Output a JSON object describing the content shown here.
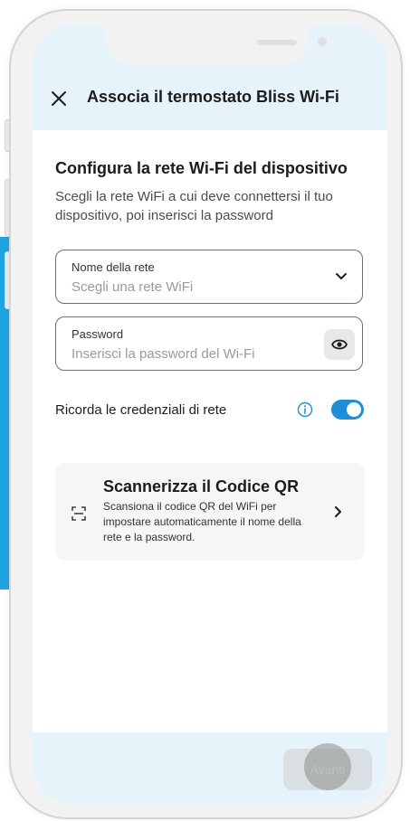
{
  "header": {
    "close_icon": "close-icon",
    "title": "Associa il termostato Bliss Wi-Fi"
  },
  "section": {
    "title": "Configura la rete Wi-Fi del dispositivo",
    "description": "Scegli la rete WiFi a cui deve connettersi il tuo dispositivo, poi inserisci la password"
  },
  "network_field": {
    "label": "Nome della rete",
    "placeholder": "Scegli una rete WiFi",
    "icon": "chevron-down-icon"
  },
  "password_field": {
    "label": "Password",
    "placeholder": "Inserisci la password del Wi-Fi",
    "icon": "eye-icon"
  },
  "remember": {
    "label": "Ricorda le credenziali di rete",
    "info_icon": "info-icon",
    "enabled": true
  },
  "qr_card": {
    "title": "Scannerizza il Codice QR",
    "description": "Scansiona il codice QR del WiFi per impostare automaticamente il nome della rete e la password.",
    "icon": "qr-scan-icon",
    "chevron": "chevron-right-icon"
  },
  "footer": {
    "next_label": "Avanti"
  },
  "colors": {
    "accent": "#1c8fd6",
    "header_bg": "#e7f3fa",
    "side_band": "#1fa4e2"
  }
}
